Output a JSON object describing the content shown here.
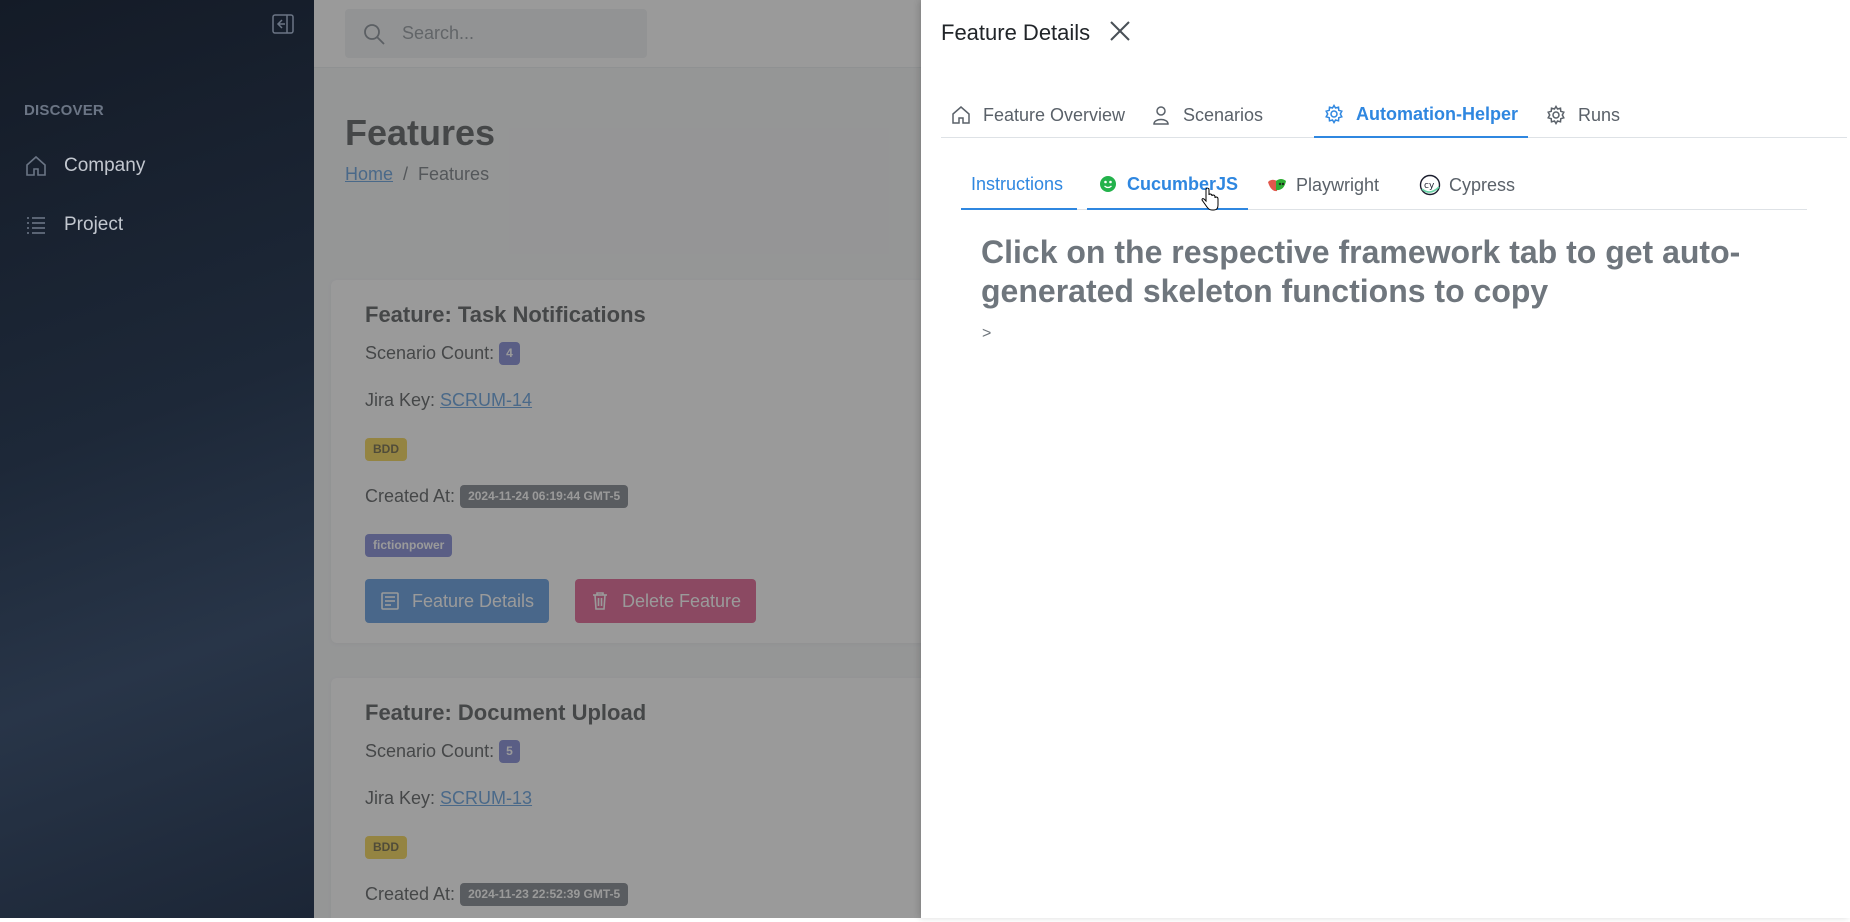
{
  "sidebar": {
    "section_label": "DISCOVER",
    "items": [
      {
        "label": "Company",
        "icon": "home-icon"
      },
      {
        "label": "Project",
        "icon": "list-icon"
      }
    ]
  },
  "topbar": {
    "search_placeholder": "Search..."
  },
  "page": {
    "title": "Features",
    "breadcrumb": {
      "home": "Home",
      "separator": "/",
      "current": "Features"
    }
  },
  "features": [
    {
      "title": "Feature: Task Notifications",
      "scenario_label": "Scenario Count:",
      "scenario_count": "4",
      "jira_label": "Jira Key:",
      "jira_key": "SCRUM-14",
      "type_badge": "BDD",
      "created_label": "Created At:",
      "created_at": "2024-11-24 06:19:44 GMT-5",
      "tag": "fictionpower",
      "details_button": "Feature Details",
      "delete_button": "Delete Feature"
    },
    {
      "title": "Feature: Document Upload",
      "scenario_label": "Scenario Count:",
      "scenario_count": "5",
      "jira_label": "Jira Key:",
      "jira_key": "SCRUM-13",
      "type_badge": "BDD",
      "created_label": "Created At:",
      "created_at": "2024-11-23 22:52:39 GMT-5"
    }
  ],
  "panel": {
    "title": "Feature Details",
    "tabs": [
      {
        "label": "Feature Overview",
        "icon": "home-icon"
      },
      {
        "label": "Scenarios",
        "icon": "user-icon"
      },
      {
        "label": "Automation-Helper",
        "icon": "gear-icon",
        "active": true
      },
      {
        "label": "Runs",
        "icon": "gear-icon"
      }
    ],
    "subtabs": [
      {
        "label": "Instructions"
      },
      {
        "label": "CucumberJS",
        "icon": "cucumber-icon",
        "active": true
      },
      {
        "label": "Playwright",
        "icon": "playwright-icon"
      },
      {
        "label": "Cypress",
        "icon": "cypress-icon"
      }
    ],
    "instruction_text": "Click on the respective framework tab to get auto-generated skeleton functions to copy",
    "caret": ">"
  },
  "colors": {
    "accent": "#2f87e0",
    "primary_button": "#2b7ad6",
    "danger_button": "#d72a6c",
    "badge_count": "#5861c9",
    "badge_bdd": "#f0c419",
    "badge_date": "#565e66"
  }
}
